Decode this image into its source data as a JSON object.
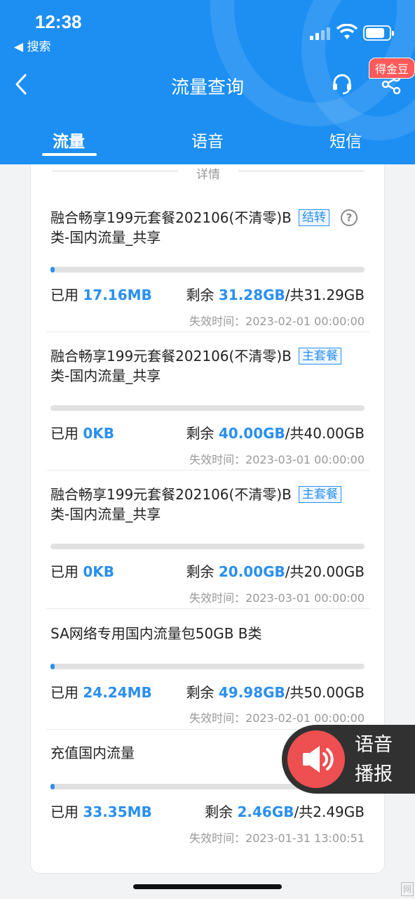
{
  "status_bar": {
    "time": "12:38",
    "back_app": "◀ 搜索"
  },
  "nav": {
    "title": "流量查询",
    "badge": "得金豆",
    "icons": [
      "back-icon",
      "customer-service-icon",
      "share-icon"
    ]
  },
  "tabs": [
    {
      "label": "流量",
      "active": true
    },
    {
      "label": "语音",
      "active": false
    },
    {
      "label": "短信",
      "active": false
    }
  ],
  "section_title": "详情",
  "items": [
    {
      "name": "融合畅享199元套餐202106(不清零)B类-国内流量_共享",
      "tag": "结转",
      "help_icon": "?",
      "progress": 0.005,
      "used_label": "已用",
      "used": "17.16MB",
      "remain_label": "剩余",
      "remain": "31.28GB",
      "total": "/共31.29GB",
      "expire": "失效时间：2023-02-01 00:00:00"
    },
    {
      "name": "融合畅享199元套餐202106(不清零)B类-国内流量_共享",
      "tag": "主套餐",
      "progress": 0,
      "used_label": "已用",
      "used": "0KB",
      "remain_label": "剩余",
      "remain": "40.00GB",
      "total": "/共40.00GB",
      "expire": "失效时间：2023-03-01 00:00:00"
    },
    {
      "name": "融合畅享199元套餐202106(不清零)B类-国内流量_共享",
      "tag": "主套餐",
      "progress": 0,
      "used_label": "已用",
      "used": "0KB",
      "remain_label": "剩余",
      "remain": "20.00GB",
      "total": "/共20.00GB",
      "expire": "失效时间：2023-03-01 00:00:00"
    },
    {
      "name": "SA网络专用国内流量包50GB B类",
      "progress": 0.0005,
      "used_label": "已用",
      "used": "24.24MB",
      "remain_label": "剩余",
      "remain": "49.98GB",
      "total": "/共50.00GB",
      "expire": "失效时间：2023-02-01 00:00:00"
    },
    {
      "name": "充值国内流量",
      "progress": 0.013,
      "used_label": "已用",
      "used": "33.35MB",
      "remain_label": "剩余",
      "remain": "2.46GB",
      "total": "/共2.49GB",
      "expire": "失效时间：2023-01-31 13:00:51"
    }
  ],
  "voice_button": {
    "line1": "语音",
    "line2": "播报"
  },
  "colors": {
    "header": "#1d8ff3",
    "accent": "#2a8ff0",
    "voice_circle": "#ee4f50"
  }
}
